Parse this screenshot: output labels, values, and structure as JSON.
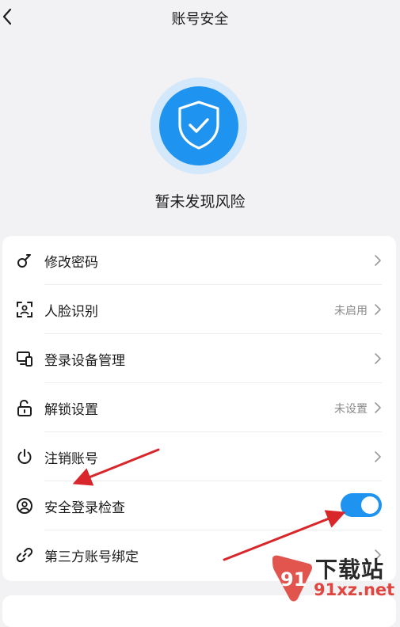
{
  "header": {
    "title": "账号安全",
    "back_icon": "chevron-left-icon"
  },
  "status": {
    "text": "暂未发现风险",
    "icon": "shield-check-icon",
    "color": "#1e93f0"
  },
  "security_items": [
    {
      "label": "修改密码",
      "value": "",
      "icon": "key-icon",
      "control": "chevron"
    },
    {
      "label": "人脸识别",
      "value": "未启用",
      "icon": "face-scan-icon",
      "control": "chevron"
    },
    {
      "label": "登录设备管理",
      "value": "",
      "icon": "devices-icon",
      "control": "chevron"
    },
    {
      "label": "解锁设置",
      "value": "未设置",
      "icon": "unlock-icon",
      "control": "chevron"
    },
    {
      "label": "注销账号",
      "value": "",
      "icon": "power-icon",
      "control": "chevron"
    },
    {
      "label": "安全登录检查",
      "value": "",
      "icon": "user-circle-icon",
      "control": "toggle",
      "toggle_on": true
    },
    {
      "label": "第三方账号绑定",
      "value": "",
      "icon": "link-icon",
      "control": "chevron"
    }
  ],
  "annotations": {
    "arrow_color": "#d9262b",
    "count": 2
  },
  "watermark": {
    "title": "下载站",
    "domain": "91xz.net",
    "logo_text": "91"
  }
}
